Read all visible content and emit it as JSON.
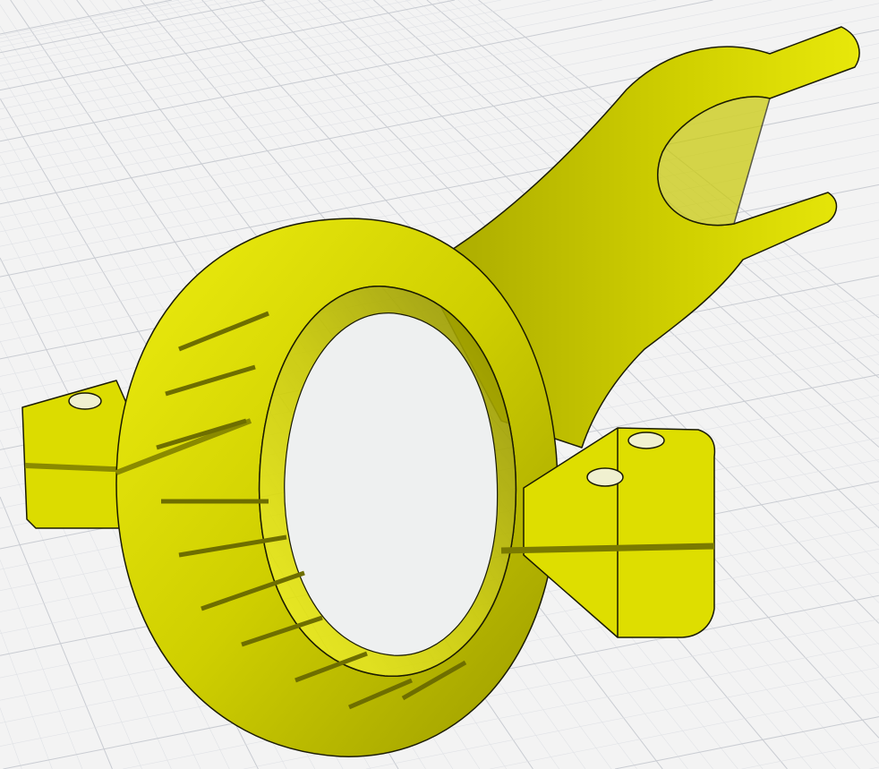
{
  "viewport": {
    "background_color": "#f3f3f3",
    "grid_color": "#c9ccd2",
    "grid_minor_color": "#e0e2e6"
  },
  "model": {
    "body_color": "#d8d800",
    "highlight_color": "#f2f20a",
    "shadow_color": "#6e6e00",
    "edge_color": "#1a1a00",
    "hole_color": "#f0f0d0"
  }
}
